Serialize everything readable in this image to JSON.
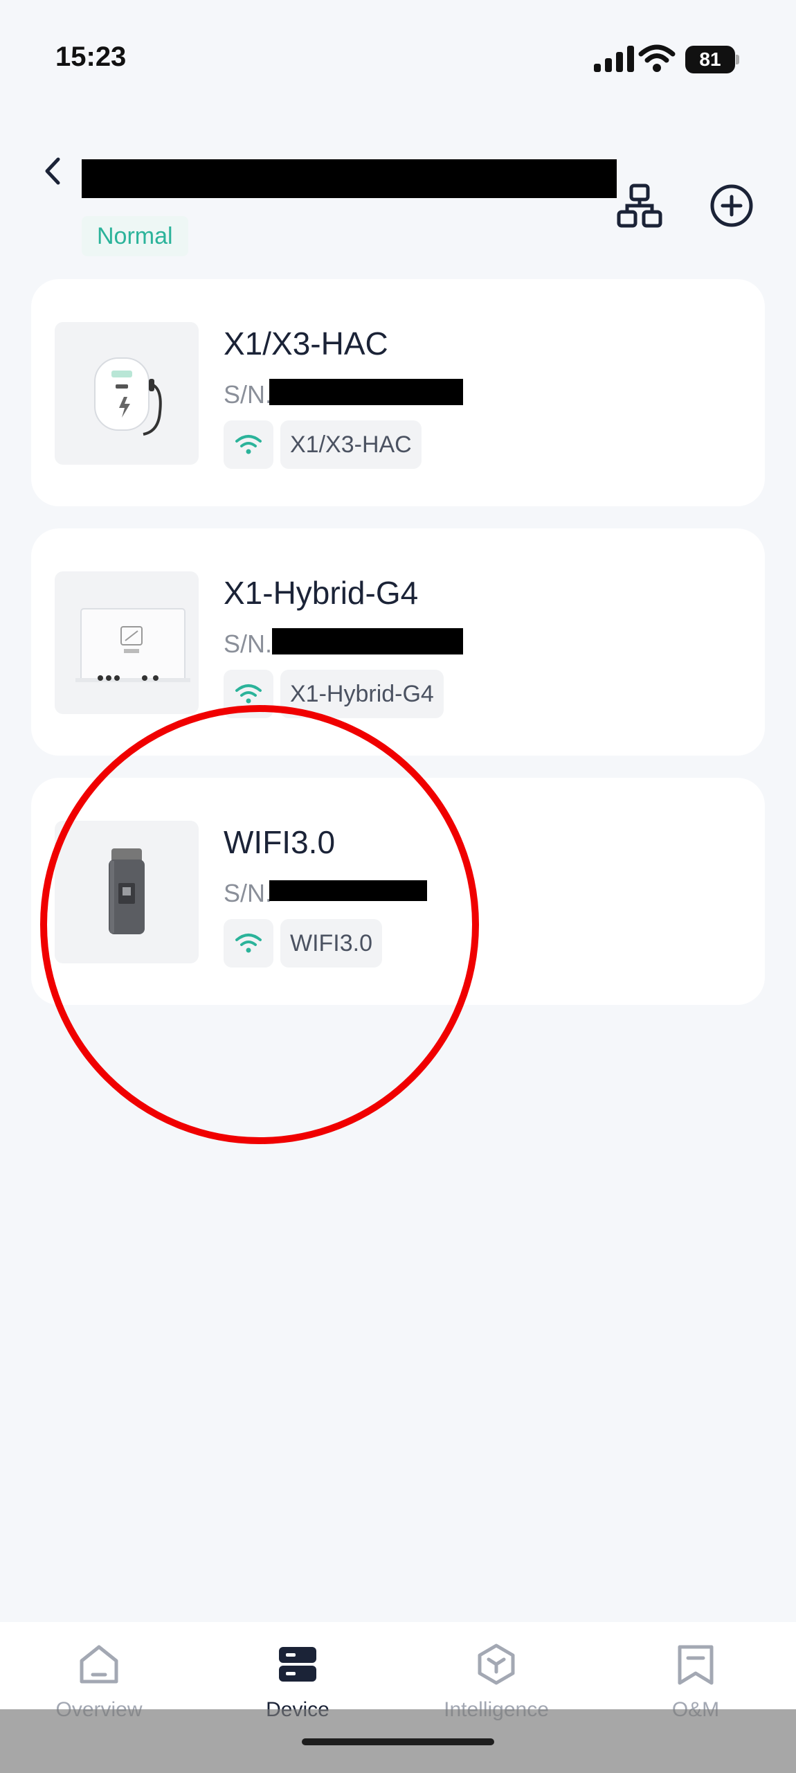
{
  "status_bar": {
    "time": "15:23",
    "battery": "81"
  },
  "header": {
    "status_badge": "Normal"
  },
  "devices": [
    {
      "name": "X1/X3-HAC",
      "sn_label": "S/N.",
      "model_tag": "X1/X3-HAC"
    },
    {
      "name": "X1-Hybrid-G4",
      "sn_label": "S/N.",
      "model_tag": "X1-Hybrid-G4"
    },
    {
      "name": "WIFI3.0",
      "sn_label": "S/N.",
      "model_tag": "WIFI3.0"
    }
  ],
  "bottom_nav": [
    {
      "label": "Overview",
      "icon": "home-icon",
      "active": false
    },
    {
      "label": "Device",
      "icon": "device-icon",
      "active": true
    },
    {
      "label": "Intelligence",
      "icon": "intelligence-icon",
      "active": false
    },
    {
      "label": "O&M",
      "icon": "bookmark-icon",
      "active": false
    }
  ],
  "colors": {
    "accent": "#2bb39a",
    "text": "#1b2337",
    "annotation": "#f00000"
  }
}
